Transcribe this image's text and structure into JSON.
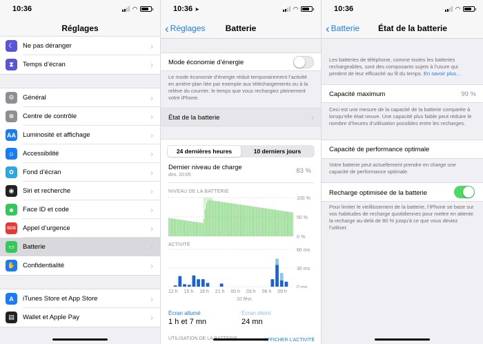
{
  "colors": {
    "accent": "#1a7cf5",
    "green": "#4cd964",
    "barGreen": "#7ed378",
    "barBlue": "#1a60d6",
    "barLightBlue": "#8cc3f0"
  },
  "screens": [
    {
      "time": "10:36",
      "title": "Réglages",
      "groups": [
        [
          {
            "label": "Ne pas déranger",
            "icon": "moon-icon",
            "color": "#5a55d6",
            "glyph": "☾"
          },
          {
            "label": "Temps d’écran",
            "icon": "hourglass-icon",
            "color": "#5a55d6",
            "glyph": "⧗"
          }
        ],
        [
          {
            "label": "Général",
            "icon": "gear-icon",
            "color": "#8e8e93",
            "glyph": "⚙"
          },
          {
            "label": "Centre de contrôle",
            "icon": "toggles-icon",
            "color": "#8e8e93",
            "glyph": "⊜"
          },
          {
            "label": "Luminosité et affichage",
            "icon": "text-size-icon",
            "color": "#1a7cf5",
            "glyph": "AA"
          },
          {
            "label": "Accessibilité",
            "icon": "accessibility-icon",
            "color": "#1a7cf5",
            "glyph": "☺"
          },
          {
            "label": "Fond d’écran",
            "icon": "flower-icon",
            "color": "#2ea6e0",
            "glyph": "✿"
          },
          {
            "label": "Siri et recherche",
            "icon": "siri-icon",
            "color": "#222",
            "glyph": "◉"
          },
          {
            "label": "Face ID et code",
            "icon": "face-id-icon",
            "color": "#34c759",
            "glyph": "☻"
          },
          {
            "label": "Appel d’urgence",
            "icon": "sos-icon",
            "color": "#e53935",
            "glyph": "SOS"
          },
          {
            "label": "Batterie",
            "icon": "battery-icon",
            "color": "#34c759",
            "glyph": "▭",
            "selected": true
          },
          {
            "label": "Confidentialité",
            "icon": "hand-icon",
            "color": "#1a7cf5",
            "glyph": "✋"
          }
        ],
        [
          {
            "label": "iTunes Store et App Store",
            "icon": "app-store-icon",
            "color": "#1a7cf5",
            "glyph": "A"
          },
          {
            "label": "Wallet et Apple Pay",
            "icon": "wallet-icon",
            "color": "#222",
            "glyph": "▤"
          }
        ]
      ]
    },
    {
      "time": "10:36",
      "back": "Réglages",
      "title": "Batterie",
      "low_power_label": "Mode économie d’énergie",
      "low_power_desc": "Le mode économie d’énergie réduit temporairement l’activité en arrière-plan liée par exemple aux téléchargements ou à la relève du courrier, le temps que vous rechargiez pleinement votre iPhone.",
      "battery_health_label": "État de la batterie",
      "tabs": [
        "24 dernières heures",
        "10 derniers jours"
      ],
      "last_charge_label": "Dernier niveau de charge",
      "last_charge_time": "dim. 20:05",
      "last_charge_value": "83 %",
      "level_title": "NIVEAU DE LA BATTERIE",
      "level_ticks": [
        "100 %",
        "50 %",
        "0 %"
      ],
      "activity_title": "ACTIVITÉ",
      "activity_ticks": [
        "60 mn",
        "30 mn",
        "0 mn"
      ],
      "x_ticks": [
        "12 h",
        "15 h",
        "18 h",
        "21 h",
        "00 h",
        "03 h",
        "06 h",
        "09 h"
      ],
      "date_label": "10 févr.",
      "screen_on_label": "Écran allumé",
      "screen_on_value": "1 h et 7 mn",
      "screen_off_label": "Écran éteint",
      "screen_off_value": "24 mn",
      "usage_title": "UTILISATION DE LA BATTERIE",
      "show_activity": "AFFICHER L’ACTIVITÉ"
    },
    {
      "time": "10:36",
      "back": "Batterie",
      "title": "État de la batterie",
      "intro": "Les batteries de téléphone, comme toutes les batteries rechargeables, sont des composants sujets à l’usure qui perdent de leur efficacité au fil du temps.",
      "learn_more": "En savoir plus…",
      "max_capacity_label": "Capacité maximum",
      "max_capacity_value": "99 %",
      "max_capacity_desc": "Ceci est une mesure de la capacité de la batterie comparée à lorsqu’elle était neuve. Une capacité plus faible peut réduire le nombre d’heures d’utilisation possibles entre les recharges.",
      "perf_label": "Capacité de performance optimale",
      "perf_desc": "Votre batterie peut actuellement prendre en charge une capacité de performance optimale.",
      "optimized_label": "Recharge optimisée de la batterie",
      "optimized_desc": "Pour limiter le vieillissement de la batterie, l’iPhone se base sur vos habitudes de recharge quotidiennes pour mettre en attente la recharge au-delà de 80 % jusqu’à ce que vous deviez l’utiliser."
    }
  ],
  "chart_data": [
    {
      "type": "bar",
      "title": "NIVEAU DE LA BATTERIE",
      "ylim": [
        0,
        100
      ],
      "yticks": [
        "100 %",
        "50 %",
        "0 %"
      ],
      "x_ticks": [
        "12 h",
        "15 h",
        "18 h",
        "21 h",
        "00 h",
        "03 h",
        "06 h",
        "09 h"
      ],
      "values": [
        47,
        47,
        46,
        46,
        45,
        45,
        44,
        44,
        43,
        43,
        42,
        42,
        41,
        41,
        40,
        40,
        39,
        39,
        38,
        38,
        37,
        37,
        36,
        36,
        35,
        35,
        34,
        45,
        70,
        85,
        92,
        94,
        94,
        93,
        92,
        92,
        91,
        91,
        90,
        90,
        89,
        89,
        88,
        88,
        87,
        87,
        86,
        86,
        85,
        85,
        84,
        84,
        83,
        83,
        82,
        82,
        81,
        81,
        80,
        80,
        79,
        79,
        78,
        78,
        77,
        77,
        76,
        76,
        75,
        75,
        74,
        74,
        73,
        73,
        72,
        72,
        71,
        71,
        70,
        70,
        69,
        69,
        68,
        68,
        67,
        67,
        66,
        66,
        65,
        65,
        64,
        64,
        63,
        63,
        62,
        62
      ],
      "charging": [
        false,
        false,
        false,
        false,
        false,
        false,
        false,
        false,
        false,
        false,
        false,
        false,
        false,
        false,
        false,
        false,
        false,
        false,
        false,
        false,
        false,
        false,
        false,
        false,
        false,
        false,
        false,
        true,
        true,
        true,
        true,
        true,
        true,
        true,
        false,
        false,
        false,
        false,
        false,
        false,
        false,
        false,
        false,
        false,
        false,
        false,
        false,
        false,
        false,
        false,
        false,
        false,
        false,
        false,
        false,
        false,
        false,
        false,
        false,
        false,
        false,
        false,
        false,
        false,
        false,
        false,
        false,
        false,
        false,
        false,
        false,
        false,
        false,
        false,
        false,
        false,
        false,
        false,
        false,
        false,
        false,
        false,
        false,
        false,
        false,
        false,
        false,
        false,
        false,
        false,
        false,
        false,
        false,
        false,
        false,
        false
      ]
    },
    {
      "type": "bar",
      "title": "ACTIVITÉ",
      "ylim": [
        0,
        60
      ],
      "yticks": [
        "60 mn",
        "30 mn",
        "0 mn"
      ],
      "x_ticks": [
        "12 h",
        "15 h",
        "18 h",
        "21 h",
        "00 h",
        "03 h",
        "06 h",
        "09 h"
      ],
      "series": [
        {
          "values": [
            0,
            2,
            17,
            4,
            3,
            18,
            12,
            12,
            6,
            0,
            0,
            5,
            0,
            0,
            0,
            0,
            0,
            0,
            0,
            0,
            0,
            0,
            12,
            35,
            10,
            8,
            0
          ]
        },
        {
          "values": [
            0,
            0,
            0,
            0,
            0,
            0,
            0,
            0,
            0,
            0,
            0,
            0,
            0,
            0,
            0,
            0,
            0,
            0,
            0,
            0,
            0,
            0,
            0,
            10,
            12,
            0,
            0
          ]
        }
      ]
    }
  ]
}
